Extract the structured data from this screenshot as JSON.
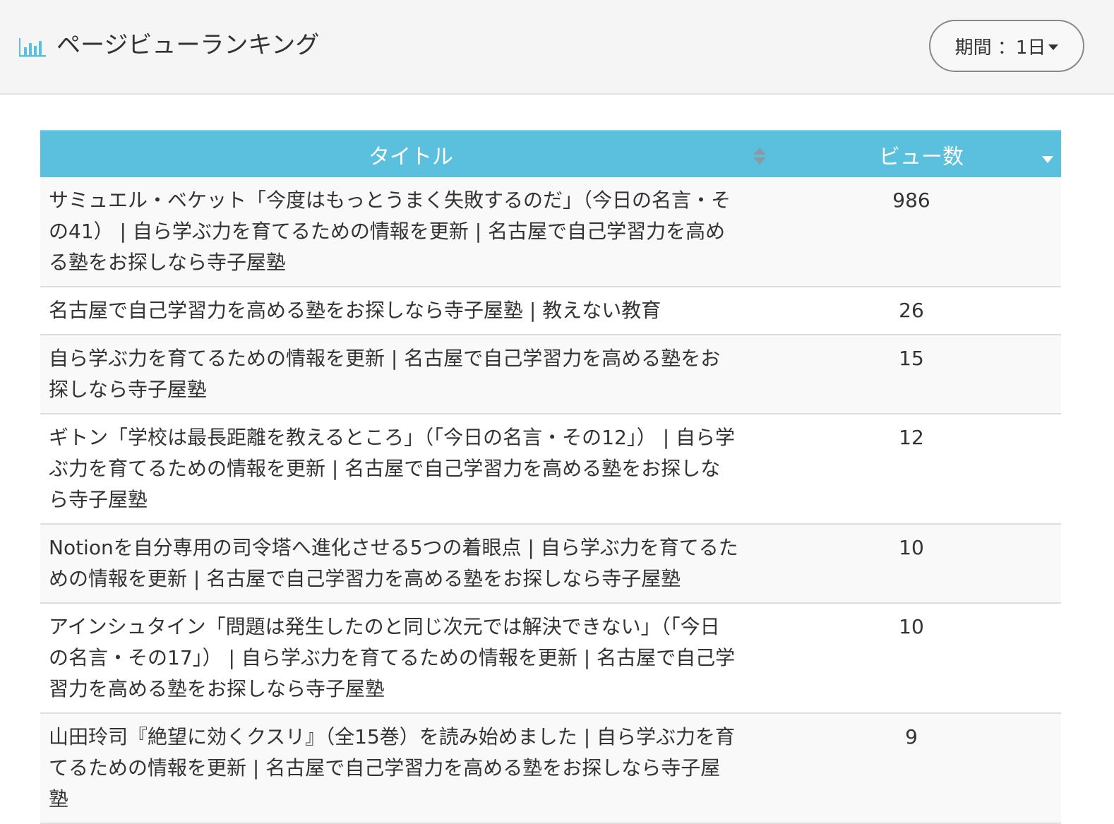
{
  "header": {
    "title": "ページビューランキング",
    "icon": "bar-chart-icon",
    "accent_color": "#5bc0de"
  },
  "period": {
    "label": "期間 ：1日"
  },
  "table": {
    "header_color": "#5bc0de",
    "columns": {
      "title": "タイトル",
      "views": "ビュー数"
    },
    "rows": [
      {
        "title": "サミュエル・ベケット「今度はもっとうまく失敗するのだ」（今日の名言・その41） | 自ら学ぶ力を育てるための情報を更新 | 名古屋で自己学習力を高める塾をお探しなら寺子屋塾",
        "views": "986"
      },
      {
        "title": "名古屋で自己学習力を高める塾をお探しなら寺子屋塾 | 教えない教育",
        "views": "26"
      },
      {
        "title": "自ら学ぶ力を育てるための情報を更新 | 名古屋で自己学習力を高める塾をお探しなら寺子屋塾",
        "views": "15"
      },
      {
        "title": "ギトン「学校は最長距離を教えるところ」（「今日の名言・その12」） | 自ら学ぶ力を育てるための情報を更新 | 名古屋で自己学習力を高める塾をお探しなら寺子屋塾",
        "views": "12"
      },
      {
        "title": "Notionを自分専用の司令塔へ進化させる5つの着眼点 | 自ら学ぶ力を育てるための情報を更新 | 名古屋で自己学習力を高める塾をお探しなら寺子屋塾",
        "views": "10"
      },
      {
        "title": "アインシュタイン「問題は発生したのと同じ次元では解決できない」（「今日の名言・その17」） | 自ら学ぶ力を育てるための情報を更新 | 名古屋で自己学習力を高める塾をお探しなら寺子屋塾",
        "views": "10"
      },
      {
        "title": "山田玲司『絶望に効くクスリ』（全15巻）を読み始めました | 自ら学ぶ力を育てるための情報を更新 | 名古屋で自己学習力を高める塾をお探しなら寺子屋塾",
        "views": "9"
      }
    ]
  }
}
